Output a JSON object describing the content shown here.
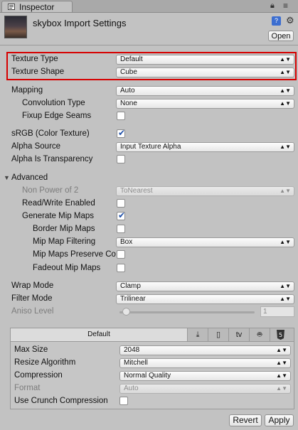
{
  "window": {
    "tab_label": "Inspector"
  },
  "header": {
    "title": "skybox Import Settings",
    "open_button": "Open"
  },
  "texture": {
    "type": {
      "label": "Texture Type",
      "value": "Default"
    },
    "shape": {
      "label": "Texture Shape",
      "value": "Cube"
    }
  },
  "mapping": {
    "label": "Mapping",
    "value": "Auto",
    "convolution": {
      "label": "Convolution Type",
      "value": "None"
    },
    "fixup": {
      "label": "Fixup Edge Seams",
      "checked": false
    }
  },
  "color": {
    "srgb": {
      "label": "sRGB (Color Texture)",
      "checked": true
    },
    "alpha_source": {
      "label": "Alpha Source",
      "value": "Input Texture Alpha"
    },
    "alpha_transparency": {
      "label": "Alpha Is Transparency",
      "checked": false
    }
  },
  "advanced": {
    "label": "Advanced",
    "npot": {
      "label": "Non Power of 2",
      "value": "ToNearest"
    },
    "readwrite": {
      "label": "Read/Write Enabled",
      "checked": false
    },
    "mipmaps": {
      "label": "Generate Mip Maps",
      "checked": true
    },
    "border_mips": {
      "label": "Border Mip Maps",
      "checked": false
    },
    "mip_filter": {
      "label": "Mip Map Filtering",
      "value": "Box"
    },
    "preserve_coverage": {
      "label": "Mip Maps Preserve Co",
      "checked": false
    },
    "fadeout": {
      "label": "Fadeout Mip Maps",
      "checked": false
    }
  },
  "sampling": {
    "wrap": {
      "label": "Wrap Mode",
      "value": "Clamp"
    },
    "filter": {
      "label": "Filter Mode",
      "value": "Trilinear"
    },
    "aniso": {
      "label": "Aniso Level",
      "value": "1",
      "slider_fraction": 0.02
    }
  },
  "platform": {
    "default_tab": "Default",
    "tab_icons": [
      "download-icon",
      "phone-icon",
      "tv-icon",
      "android-icon",
      "html5-icon"
    ],
    "tv_label": "tv",
    "max_size": {
      "label": "Max Size",
      "value": "2048"
    },
    "resize": {
      "label": "Resize Algorithm",
      "value": "Mitchell"
    },
    "compression": {
      "label": "Compression",
      "value": "Normal Quality"
    },
    "format": {
      "label": "Format",
      "value": "Auto"
    },
    "crunch": {
      "label": "Use Crunch Compression",
      "checked": false
    }
  },
  "footer": {
    "revert": "Revert",
    "apply": "Apply"
  },
  "colors": {
    "highlight": "#d60000",
    "check": "#2050a8"
  }
}
